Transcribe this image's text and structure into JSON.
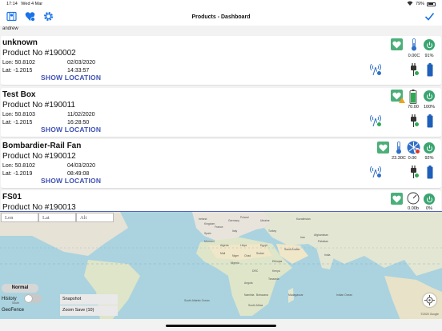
{
  "status_bar": {
    "time": "17:14",
    "date": "Wed 4 Mar",
    "battery": "79%"
  },
  "nav": {
    "title": "Products - Dashboard"
  },
  "user": "andrew",
  "products": [
    {
      "name": "unknown",
      "product_no": "Product No #190002",
      "lon": "Lon: 50.8102",
      "lat": "Lat: -1.2015",
      "date": "02/03/2020",
      "time": "14:33:57",
      "temp": "0.00C",
      "battery": "91%",
      "show_location": "SHOW LOCATION"
    },
    {
      "name": "Test Box",
      "product_no": "Product No #190011",
      "lon": "Lon: 50.8103",
      "lat": "Lat: -1.2015",
      "date": "11/02/2020",
      "time": "16:28:50",
      "value": "70.00",
      "battery": "100%",
      "show_location": "SHOW LOCATION"
    },
    {
      "name": "Bombardier-Rail Fan",
      "product_no": "Product No #190012",
      "lon": "Lon: 50.8102",
      "lat": "Lat: -1.2019",
      "date": "04/03/2020",
      "time": "08:49:08",
      "temp": "23.30C",
      "fan": "0.00",
      "battery": "92%",
      "show_location": "SHOW LOCATION"
    },
    {
      "name": "FS01",
      "product_no": "Product No #190013",
      "gauge": "0.00b",
      "battery": "0%"
    }
  ],
  "map": {
    "lon_placeholder": "Lon",
    "lat_placeholder": "Lat",
    "alt_placeholder": "Alt",
    "normal_label": "Normal",
    "history_label": "History",
    "geofence_label": "GeoFence",
    "snapshot_label": "Snapshot",
    "zoom_save_label": "Zoom Save (10)",
    "copyright": "©2020 Google",
    "places": {
      "ireland": "Ireland",
      "kingdom": "Kingdom",
      "germany": "Germany",
      "poland": "Poland",
      "ukraine": "Ukraine",
      "kazakhstan": "Kazakhstan",
      "france": "France",
      "spain": "Spain",
      "italy": "Italy",
      "turkey": "Turkey",
      "morocco": "Morocco",
      "algeria": "Algeria",
      "libya": "Libya",
      "egypt": "Egypt",
      "saudi_arabia": "Saudi Arabia",
      "iran": "Iran",
      "afghanistan": "Afghanistan",
      "pakistan": "Pakistan",
      "india": "India",
      "mali": "Mali",
      "niger": "Niger",
      "chad": "Chad",
      "sudan": "Sudan",
      "nigeria": "Nigeria",
      "ethiopia": "Ethiopia",
      "drc": "DRC",
      "kenya": "Kenya",
      "tanzania": "Tanzania",
      "angola": "Angola",
      "namibia": "Namibia",
      "botswana": "Botswana",
      "south_africa": "South Africa",
      "madagascar": "Madagascar",
      "south_atlantic_ocean": "South Atlantic Ocean",
      "indian_ocean": "Indian Ocean",
      "south": "South"
    }
  },
  "colors": {
    "accent": "#1a73e8",
    "healthy": "#4caf7a",
    "power": "#3aa571",
    "link": "#3f51b5"
  }
}
